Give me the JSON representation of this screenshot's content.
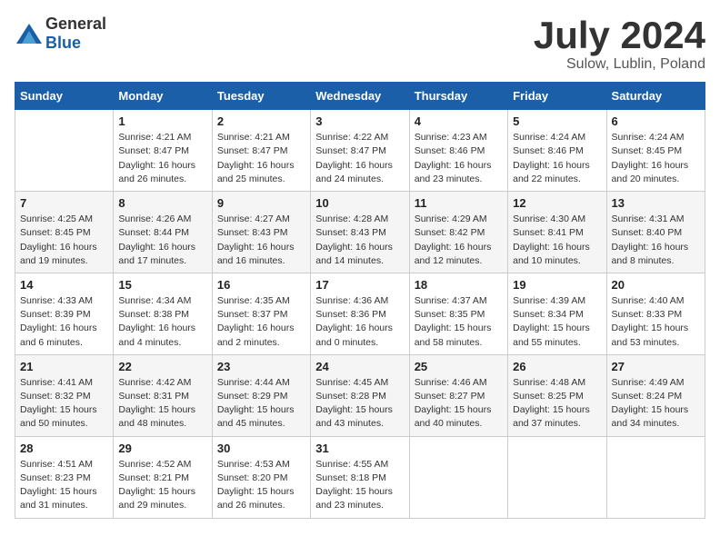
{
  "header": {
    "logo_general": "General",
    "logo_blue": "Blue",
    "month_title": "July 2024",
    "location": "Sulow, Lublin, Poland"
  },
  "weekdays": [
    "Sunday",
    "Monday",
    "Tuesday",
    "Wednesday",
    "Thursday",
    "Friday",
    "Saturday"
  ],
  "weeks": [
    [
      {
        "day": null,
        "info": null
      },
      {
        "day": "1",
        "info": "Sunrise: 4:21 AM\nSunset: 8:47 PM\nDaylight: 16 hours\nand 26 minutes."
      },
      {
        "day": "2",
        "info": "Sunrise: 4:21 AM\nSunset: 8:47 PM\nDaylight: 16 hours\nand 25 minutes."
      },
      {
        "day": "3",
        "info": "Sunrise: 4:22 AM\nSunset: 8:47 PM\nDaylight: 16 hours\nand 24 minutes."
      },
      {
        "day": "4",
        "info": "Sunrise: 4:23 AM\nSunset: 8:46 PM\nDaylight: 16 hours\nand 23 minutes."
      },
      {
        "day": "5",
        "info": "Sunrise: 4:24 AM\nSunset: 8:46 PM\nDaylight: 16 hours\nand 22 minutes."
      },
      {
        "day": "6",
        "info": "Sunrise: 4:24 AM\nSunset: 8:45 PM\nDaylight: 16 hours\nand 20 minutes."
      }
    ],
    [
      {
        "day": "7",
        "info": "Sunrise: 4:25 AM\nSunset: 8:45 PM\nDaylight: 16 hours\nand 19 minutes."
      },
      {
        "day": "8",
        "info": "Sunrise: 4:26 AM\nSunset: 8:44 PM\nDaylight: 16 hours\nand 17 minutes."
      },
      {
        "day": "9",
        "info": "Sunrise: 4:27 AM\nSunset: 8:43 PM\nDaylight: 16 hours\nand 16 minutes."
      },
      {
        "day": "10",
        "info": "Sunrise: 4:28 AM\nSunset: 8:43 PM\nDaylight: 16 hours\nand 14 minutes."
      },
      {
        "day": "11",
        "info": "Sunrise: 4:29 AM\nSunset: 8:42 PM\nDaylight: 16 hours\nand 12 minutes."
      },
      {
        "day": "12",
        "info": "Sunrise: 4:30 AM\nSunset: 8:41 PM\nDaylight: 16 hours\nand 10 minutes."
      },
      {
        "day": "13",
        "info": "Sunrise: 4:31 AM\nSunset: 8:40 PM\nDaylight: 16 hours\nand 8 minutes."
      }
    ],
    [
      {
        "day": "14",
        "info": "Sunrise: 4:33 AM\nSunset: 8:39 PM\nDaylight: 16 hours\nand 6 minutes."
      },
      {
        "day": "15",
        "info": "Sunrise: 4:34 AM\nSunset: 8:38 PM\nDaylight: 16 hours\nand 4 minutes."
      },
      {
        "day": "16",
        "info": "Sunrise: 4:35 AM\nSunset: 8:37 PM\nDaylight: 16 hours\nand 2 minutes."
      },
      {
        "day": "17",
        "info": "Sunrise: 4:36 AM\nSunset: 8:36 PM\nDaylight: 16 hours\nand 0 minutes."
      },
      {
        "day": "18",
        "info": "Sunrise: 4:37 AM\nSunset: 8:35 PM\nDaylight: 15 hours\nand 58 minutes."
      },
      {
        "day": "19",
        "info": "Sunrise: 4:39 AM\nSunset: 8:34 PM\nDaylight: 15 hours\nand 55 minutes."
      },
      {
        "day": "20",
        "info": "Sunrise: 4:40 AM\nSunset: 8:33 PM\nDaylight: 15 hours\nand 53 minutes."
      }
    ],
    [
      {
        "day": "21",
        "info": "Sunrise: 4:41 AM\nSunset: 8:32 PM\nDaylight: 15 hours\nand 50 minutes."
      },
      {
        "day": "22",
        "info": "Sunrise: 4:42 AM\nSunset: 8:31 PM\nDaylight: 15 hours\nand 48 minutes."
      },
      {
        "day": "23",
        "info": "Sunrise: 4:44 AM\nSunset: 8:29 PM\nDaylight: 15 hours\nand 45 minutes."
      },
      {
        "day": "24",
        "info": "Sunrise: 4:45 AM\nSunset: 8:28 PM\nDaylight: 15 hours\nand 43 minutes."
      },
      {
        "day": "25",
        "info": "Sunrise: 4:46 AM\nSunset: 8:27 PM\nDaylight: 15 hours\nand 40 minutes."
      },
      {
        "day": "26",
        "info": "Sunrise: 4:48 AM\nSunset: 8:25 PM\nDaylight: 15 hours\nand 37 minutes."
      },
      {
        "day": "27",
        "info": "Sunrise: 4:49 AM\nSunset: 8:24 PM\nDaylight: 15 hours\nand 34 minutes."
      }
    ],
    [
      {
        "day": "28",
        "info": "Sunrise: 4:51 AM\nSunset: 8:23 PM\nDaylight: 15 hours\nand 31 minutes."
      },
      {
        "day": "29",
        "info": "Sunrise: 4:52 AM\nSunset: 8:21 PM\nDaylight: 15 hours\nand 29 minutes."
      },
      {
        "day": "30",
        "info": "Sunrise: 4:53 AM\nSunset: 8:20 PM\nDaylight: 15 hours\nand 26 minutes."
      },
      {
        "day": "31",
        "info": "Sunrise: 4:55 AM\nSunset: 8:18 PM\nDaylight: 15 hours\nand 23 minutes."
      },
      {
        "day": null,
        "info": null
      },
      {
        "day": null,
        "info": null
      },
      {
        "day": null,
        "info": null
      }
    ]
  ]
}
